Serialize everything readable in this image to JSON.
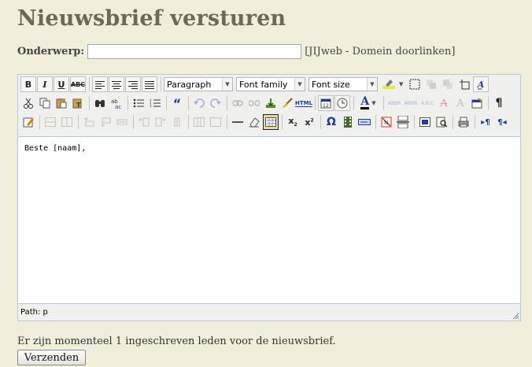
{
  "page": {
    "title": "Nieuwsbrief versturen",
    "subject_label": "Onderwerp:",
    "subject_value": "",
    "subject_note": "[JIJweb - Domein doorlinken]",
    "member_count_text": "Er zijn momenteel 1 ingeschreven leden voor de nieuwsbrief.",
    "send_label": "Verzenden"
  },
  "editor": {
    "format_select": "Paragraph",
    "fontfamily_select": "Font family",
    "fontsize_select": "Font size",
    "content": "Beste [naam],",
    "path_label": "Path: p",
    "glyphs": {
      "bold": "B",
      "italic": "I",
      "underline": "U",
      "strike": "ABC",
      "quote": "“",
      "html": "HTML",
      "omega": "Ω",
      "paragraph": "¶",
      "fontcolor": "A",
      "styleprops": "A̲"
    }
  },
  "colors": {
    "background": "#f1eedb",
    "title": "#6b6a52",
    "editor_border": "#b9c9d9"
  }
}
